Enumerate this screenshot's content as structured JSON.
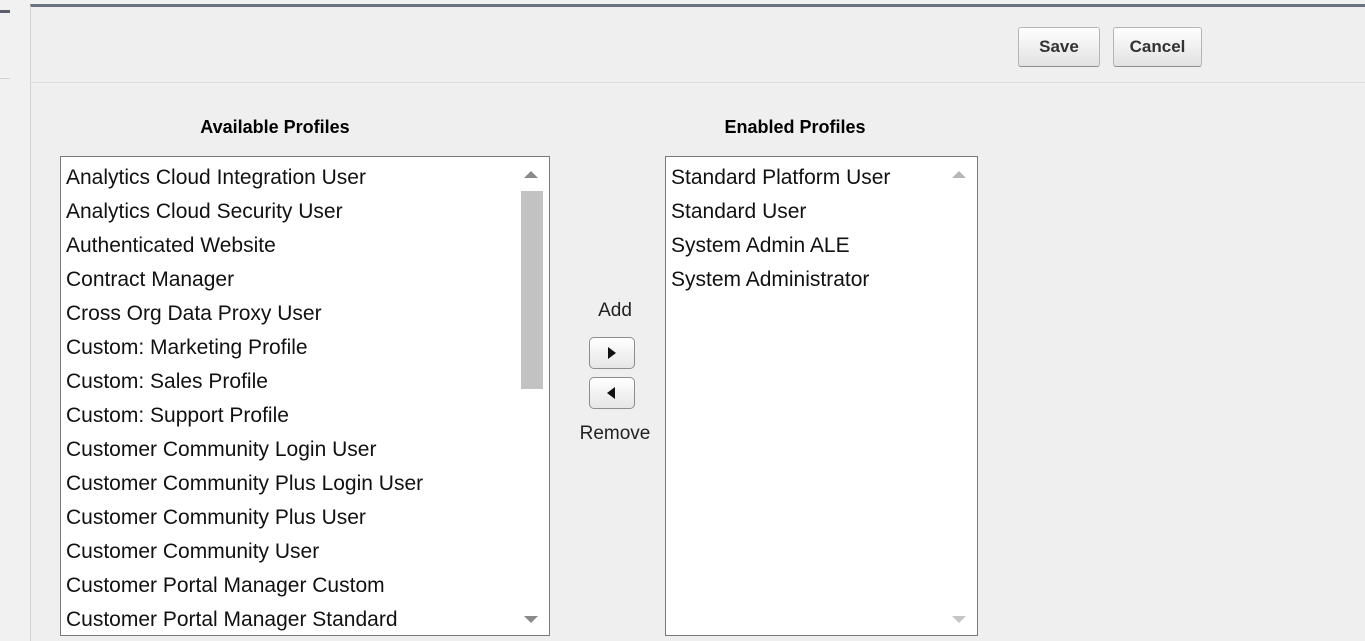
{
  "toolbar": {
    "save_label": "Save",
    "cancel_label": "Cancel"
  },
  "available_profiles": {
    "title": "Available Profiles",
    "items": [
      "Analytics Cloud Integration User",
      "Analytics Cloud Security User",
      "Authenticated Website",
      "Contract Manager",
      "Cross Org Data Proxy User",
      "Custom: Marketing Profile",
      "Custom: Sales Profile",
      "Custom: Support Profile",
      "Customer Community Login User",
      "Customer Community Plus Login User",
      "Customer Community Plus User",
      "Customer Community User",
      "Customer Portal Manager Custom",
      "Customer Portal Manager Standard"
    ]
  },
  "enabled_profiles": {
    "title": "Enabled Profiles",
    "items": [
      "Standard Platform User",
      "Standard User",
      "System Admin ALE",
      "System Administrator"
    ]
  },
  "move_controls": {
    "add_label": "Add",
    "remove_label": "Remove",
    "add_icon": "arrow-right-icon",
    "remove_icon": "arrow-left-icon"
  },
  "colors": {
    "header_accent": "#6b7383",
    "background": "#f1f1f1"
  }
}
